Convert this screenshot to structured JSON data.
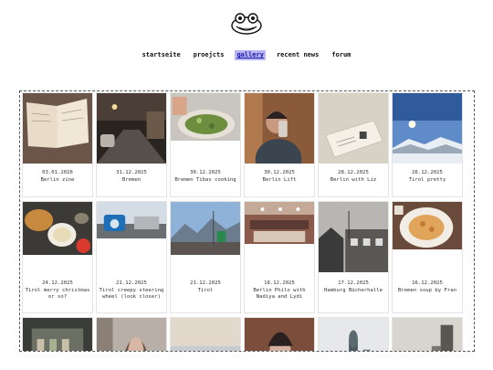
{
  "site": {
    "logo_icon": "frog-logo-icon"
  },
  "nav": {
    "items": [
      {
        "label": "startseite",
        "active": false
      },
      {
        "label": "proejcts",
        "active": false
      },
      {
        "label": "gallery",
        "active": true
      },
      {
        "label": "recent news",
        "active": false
      },
      {
        "label": "forum",
        "active": false
      }
    ]
  },
  "gallery": {
    "items": [
      {
        "date": "03.01.2026",
        "title": "Berlin zine"
      },
      {
        "date": "31.12.2025",
        "title": "Bremen"
      },
      {
        "date": "30.12.2025",
        "title": "Bremen Tibas cooking"
      },
      {
        "date": "30.12.2025",
        "title": "Berlin Lift"
      },
      {
        "date": "28.12.2025",
        "title": "Berlin with Liz"
      },
      {
        "date": "26.12.2025",
        "title": "Tirol pretty"
      },
      {
        "date": "24.12.2025",
        "title": "Tirol merry christmas or so?"
      },
      {
        "date": "21.12.2025",
        "title": "Tirol creepy steering wheel (look closer)"
      },
      {
        "date": "21.12.2025",
        "title": "Tirol"
      },
      {
        "date": "18.12.2025",
        "title": "Berlin Philo with Nadiya and Lydi"
      },
      {
        "date": "17.12.2025",
        "title": "Hamburg Bücherhalle"
      },
      {
        "date": "16.12.2025",
        "title": "Bremen soup by Fran"
      }
    ],
    "partial_row": 6
  },
  "colors": {
    "nav_active_bg": "#b9b4f6",
    "frame_border": "#555555"
  }
}
